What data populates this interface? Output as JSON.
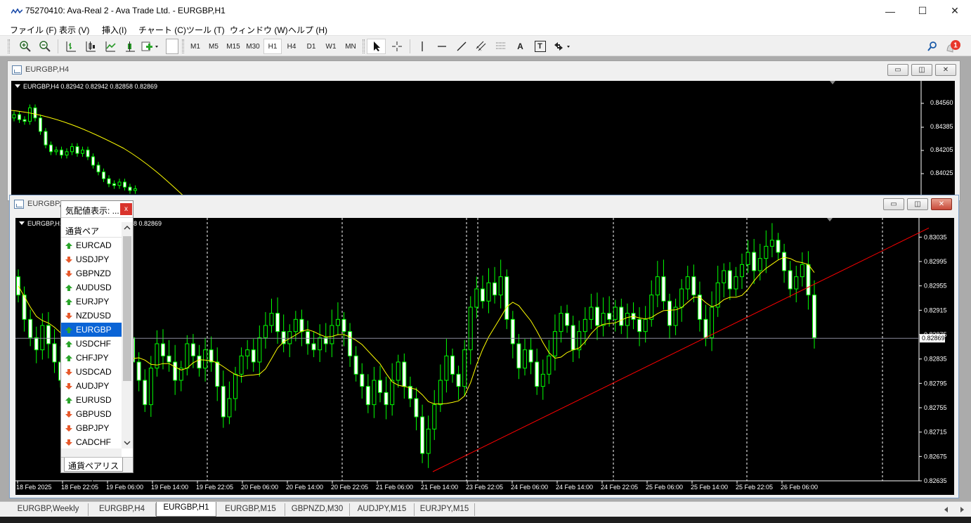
{
  "window": {
    "title": "75270410: Ava-Real 2 - Ava Trade Ltd. - EURGBP,H1",
    "minimize": "—",
    "maximize": "☐",
    "close": "✕"
  },
  "menu": [
    "ファイル (F)",
    "表示 (V)",
    "挿入(I)",
    "チャート (C)",
    "ツール (T)",
    "ウィンドウ (W)",
    "ヘルプ (H)"
  ],
  "toolbar": {
    "timeframes": [
      "M1",
      "M5",
      "M15",
      "M30",
      "H1",
      "H4",
      "D1",
      "W1",
      "MN"
    ],
    "selected_timeframe": "H1",
    "text_tool": "A",
    "label_tool": "T",
    "notification_count": "1"
  },
  "h4_window": {
    "title": "EURGBP,H4",
    "ohlc": "EURGBP,H4  0.82942 0.82942 0.82858 0.82869",
    "price_labels": [
      "0.84560",
      "0.84385",
      "0.84205",
      "0.84025"
    ]
  },
  "h1_window": {
    "title": "EURGBP,H1",
    "ohlc": "EURGBP,H1  0.82942 0.82942 0.82858 0.82869",
    "current_price": "0.82869"
  },
  "market_watch": {
    "title": "気配値表示: ...",
    "close": "x",
    "column": "通貨ペア",
    "tab": "通貨ペアリスト",
    "selected": "EURGBP",
    "symbols": [
      {
        "name": "EURCAD",
        "dir": "up"
      },
      {
        "name": "USDJPY",
        "dir": "down"
      },
      {
        "name": "GBPNZD",
        "dir": "down"
      },
      {
        "name": "AUDUSD",
        "dir": "up"
      },
      {
        "name": "EURJPY",
        "dir": "up"
      },
      {
        "name": "NZDUSD",
        "dir": "down"
      },
      {
        "name": "EURGBP",
        "dir": "up"
      },
      {
        "name": "USDCHF",
        "dir": "up"
      },
      {
        "name": "CHFJPY",
        "dir": "up"
      },
      {
        "name": "USDCAD",
        "dir": "down"
      },
      {
        "name": "AUDJPY",
        "dir": "down"
      },
      {
        "name": "EURUSD",
        "dir": "up"
      },
      {
        "name": "GBPUSD",
        "dir": "down"
      },
      {
        "name": "GBPJPY",
        "dir": "down"
      },
      {
        "name": "CADCHF",
        "dir": "down"
      }
    ]
  },
  "bottom_tabs": [
    "EURGBP,Weekly",
    "EURGBP,H4",
    "EURGBP,H1",
    "EURGBP,M15",
    "GBPNZD,M30",
    "AUDJPY,M15",
    "EURJPY,M15"
  ],
  "active_tab": "EURGBP,H1",
  "colors": {
    "bull_candle": "#000000",
    "bull_outline": "#00ff00",
    "bear_candle": "#ffffff",
    "wick": "#00ff00",
    "moving_average": "#ffff00",
    "trendline": "#ff0000",
    "background": "#000000",
    "selection": "#0a64d6"
  },
  "chart_data": {
    "type": "candlestick",
    "symbol": "EURGBP",
    "timeframe": "H1",
    "y_axis_labels": [
      "0.83035",
      "0.82995",
      "0.82955",
      "0.82915",
      "0.82875",
      "0.82835",
      "0.82795",
      "0.82755",
      "0.82715",
      "0.82675",
      "0.82635"
    ],
    "ylim": [
      0.82635,
      0.83055
    ],
    "x_axis_labels": [
      "18 Feb 2025",
      "18 Feb 22:05",
      "19 Feb 06:00",
      "19 Feb 14:00",
      "19 Feb 22:05",
      "20 Feb 06:00",
      "20 Feb 14:00",
      "20 Feb 22:05",
      "21 Feb 06:00",
      "21 Feb 14:00",
      "23 Feb 22:05",
      "24 Feb 06:00",
      "24 Feb 14:00",
      "24 Feb 22:05",
      "25 Feb 06:00",
      "25 Feb 14:00",
      "25 Feb 22:05",
      "26 Feb 06:00"
    ],
    "current_price": 0.82869,
    "trendline": {
      "from": [
        "21 Feb 14:00",
        0.8265
      ],
      "to": [
        "26 Feb",
        0.8305
      ]
    },
    "closes": [
      0.8294,
      0.829,
      0.8287,
      0.8285,
      0.8289,
      0.8286,
      0.8283,
      0.828,
      0.8283,
      0.8287,
      0.8285,
      0.8282,
      0.8279,
      0.8283,
      0.8286,
      0.8284,
      0.8282,
      0.8285,
      0.8287,
      0.8283,
      0.828,
      0.8276,
      0.8282,
      0.8286,
      0.8284,
      0.8283,
      0.828,
      0.8282,
      0.8286,
      0.8284,
      0.8282,
      0.8285,
      0.8283,
      0.8279,
      0.8274,
      0.8277,
      0.8281,
      0.8284,
      0.8285,
      0.8283,
      0.8287,
      0.8289,
      0.8291,
      0.8288,
      0.8286,
      0.8288,
      0.829,
      0.8288,
      0.8286,
      0.8285,
      0.8287,
      0.8286,
      0.8289,
      0.829,
      0.8288,
      0.8284,
      0.8281,
      0.8279,
      0.8276,
      0.828,
      0.8278,
      0.8276,
      0.828,
      0.8283,
      0.8279,
      0.8277,
      0.8274,
      0.8268,
      0.8272,
      0.8276,
      0.828,
      0.8284,
      0.8281,
      0.8279,
      0.8285,
      0.8292,
      0.8295,
      0.8293,
      0.8296,
      0.8294,
      0.8297,
      0.829,
      0.8286,
      0.8282,
      0.8285,
      0.8283,
      0.8279,
      0.8281,
      0.8284,
      0.8288,
      0.8291,
      0.8289,
      0.8285,
      0.8288,
      0.829,
      0.8292,
      0.8289,
      0.8291,
      0.829,
      0.8292,
      0.8289,
      0.8291,
      0.829,
      0.8288,
      0.829,
      0.8294,
      0.8297,
      0.8293,
      0.8289,
      0.8292,
      0.8295,
      0.8297,
      0.8294,
      0.829,
      0.8287,
      0.8292,
      0.8296,
      0.8298,
      0.8295,
      0.8297,
      0.8299,
      0.8301,
      0.8298,
      0.83,
      0.8302,
      0.8303,
      0.8301,
      0.8298,
      0.8295,
      0.8297,
      0.8299,
      0.8294,
      0.8287
    ]
  }
}
